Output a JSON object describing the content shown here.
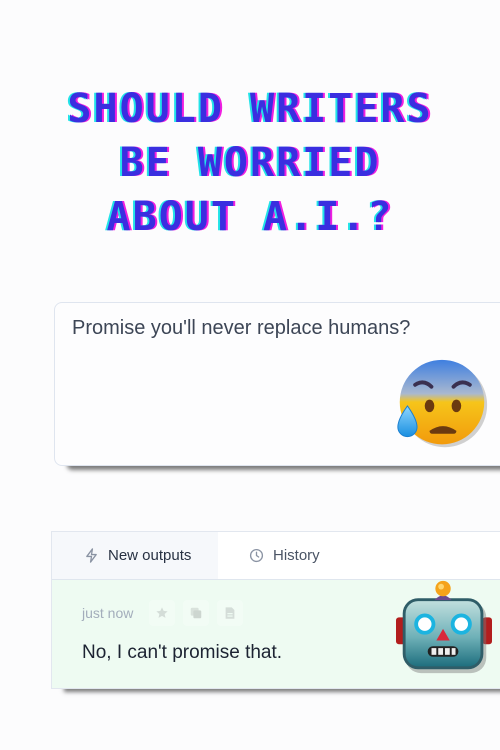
{
  "headline": {
    "lines": [
      "SHOULD WRITERS",
      "BE WORRIED",
      "ABOUT A.I.?"
    ],
    "colors": {
      "main": "#3a2ee0",
      "shadow_left": "#22e3e8",
      "shadow_right": "#f01ee0"
    }
  },
  "prompt": {
    "text": "Promise you'll never replace humans?",
    "emoji": "anxious-face-with-sweat"
  },
  "outputs_panel": {
    "tabs": [
      {
        "label": "New outputs",
        "icon": "lightning-icon",
        "active": true
      },
      {
        "label": "History",
        "icon": "clock-icon",
        "active": false
      }
    ],
    "result": {
      "timestamp": "just now",
      "actions": [
        "star-icon",
        "copy-icon",
        "document-icon"
      ],
      "text": "No, I can't promise that.",
      "emoji": "robot-face"
    },
    "background": "#eefbf2"
  }
}
